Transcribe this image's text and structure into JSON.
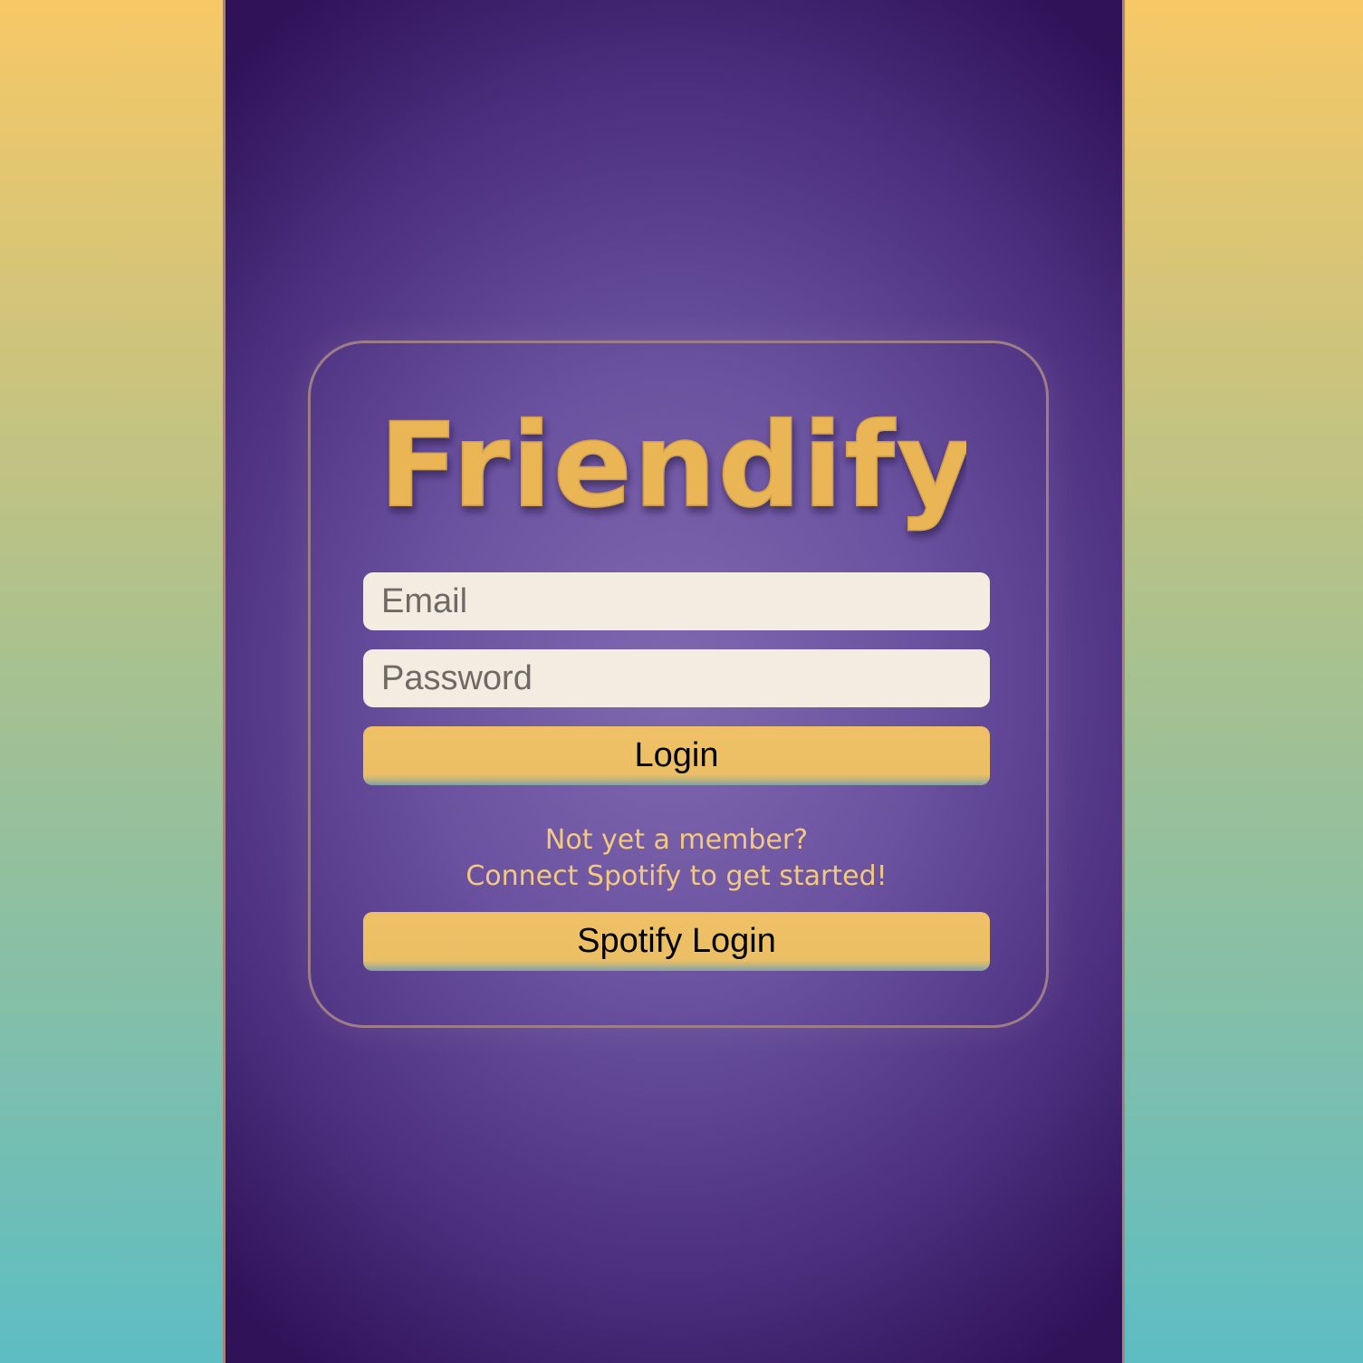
{
  "app": {
    "logo_text": "Friendify"
  },
  "login_form": {
    "email_placeholder": "Email",
    "password_placeholder": "Password",
    "login_label": "Login"
  },
  "signup": {
    "prompt_line1": "Not yet a member?",
    "prompt_line2": "Connect Spotify to get started!",
    "spotify_login_label": "Spotify Login"
  },
  "colors": {
    "accent": "#ebbf65",
    "card_border": "#9e7e86",
    "panel_center": "#8068b0",
    "panel_edge": "#2f1258",
    "field_background": "#f4ece0",
    "page_gradient_top": "#f7c866",
    "page_gradient_bottom": "#5dbdc3"
  }
}
